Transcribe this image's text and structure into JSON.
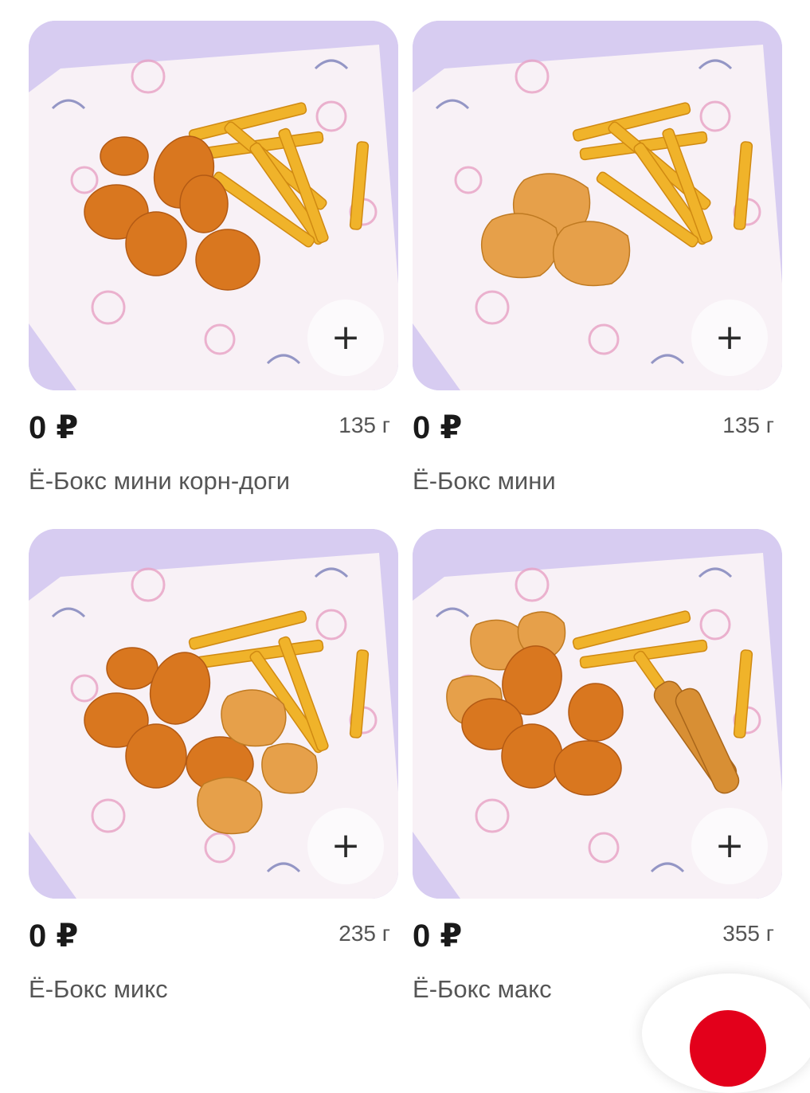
{
  "products": [
    {
      "price": "0 ₽",
      "weight": "135 г",
      "name": "Ё-Бокс мини корн-доги",
      "add_label": "+",
      "photo": "corn-dogs-and-fries"
    },
    {
      "price": "0 ₽",
      "weight": "135 г",
      "name": "Ё-Бокс мини",
      "add_label": "+",
      "photo": "nuggets-and-fries"
    },
    {
      "price": "0 ₽",
      "weight": "235 г",
      "name": "Ё-Бокс микс",
      "add_label": "+",
      "photo": "corn-dogs-nuggets-fries"
    },
    {
      "price": "0 ₽",
      "weight": "355 г",
      "name": "Ё-Бокс макс",
      "add_label": "+",
      "photo": "corn-dogs-nuggets-strips-fries"
    }
  ],
  "colors": {
    "photo_bg": "#d8cdf2",
    "accent": "#e3001b"
  }
}
